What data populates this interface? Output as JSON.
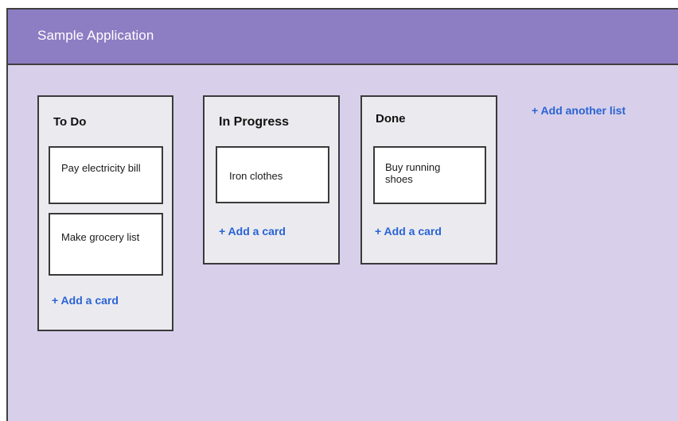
{
  "app": {
    "title": "Sample Application"
  },
  "board": {
    "lists": [
      {
        "title": "To Do",
        "cards": [
          "Pay electricity bill",
          "Make grocery list"
        ],
        "add_card_label": "+ Add a card"
      },
      {
        "title": "In Progress",
        "cards": [
          "Iron clothes"
        ],
        "add_card_label": "+ Add a card"
      },
      {
        "title": "Done",
        "cards": [
          "Buy running shoes"
        ],
        "add_card_label": "+ Add a card"
      }
    ],
    "add_list_label": "+ Add another list"
  },
  "colors": {
    "header": "#8d7dc3",
    "board_background": "#d8d0ea",
    "list_background": "#ebebef",
    "link": "#2a63d4"
  }
}
